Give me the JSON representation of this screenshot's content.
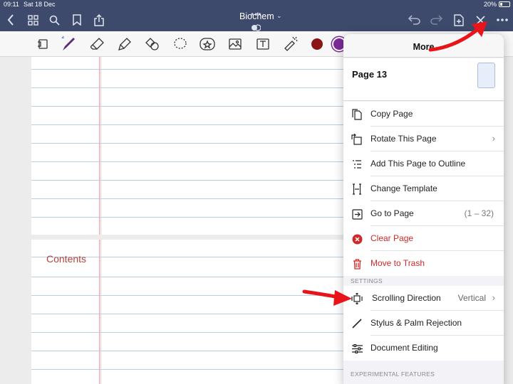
{
  "status": {
    "time": "09:11",
    "date": "Sat 18 Dec",
    "battery": "20%"
  },
  "nav": {
    "title": "Biochem",
    "icons": [
      "back-icon",
      "grid-icon",
      "search-icon",
      "bookmark-icon",
      "share-icon",
      "undo-icon",
      "redo-icon",
      "add-page-icon",
      "close-icon",
      "more-icon"
    ]
  },
  "toolbar": {
    "tools": [
      "page-view-icon",
      "pen-icon",
      "eraser-icon",
      "highlighter-icon",
      "shapes-icon",
      "lasso-icon",
      "sticker-icon",
      "image-icon",
      "text-icon",
      "laser-pointer-icon"
    ],
    "colors": [
      "#8b1515",
      "#7b2b9a"
    ]
  },
  "notebook": {
    "contents_label": "Contents"
  },
  "more_menu": {
    "title": "More",
    "page_name": "Page 13",
    "actions": [
      {
        "label": "Copy Page",
        "icon": "copy-page-icon"
      },
      {
        "label": "Rotate This Page",
        "icon": "rotate-page-icon",
        "chevron": true
      },
      {
        "label": "Add This Page to Outline",
        "icon": "outline-icon"
      },
      {
        "label": "Change Template",
        "icon": "template-icon"
      },
      {
        "label": "Go to Page",
        "icon": "go-to-page-icon",
        "detail": "(1 – 32)"
      },
      {
        "label": "Clear Page",
        "icon": "clear-icon",
        "destructive": true
      },
      {
        "label": "Move to Trash",
        "icon": "trash-icon",
        "destructive": true
      }
    ],
    "settings_header": "SETTINGS",
    "settings": [
      {
        "label": "Scrolling Direction",
        "icon": "scroll-direction-icon",
        "value": "Vertical",
        "chevron": true
      },
      {
        "label": "Stylus & Palm Rejection",
        "icon": "stylus-icon"
      },
      {
        "label": "Document Editing",
        "icon": "sliders-icon"
      }
    ],
    "experimental_header": "EXPERIMENTAL FEATURES"
  },
  "colors": {
    "navbar": "#3d4a6b",
    "destructive": "#cf2a2a",
    "annotation_arrow": "#e8141a"
  }
}
